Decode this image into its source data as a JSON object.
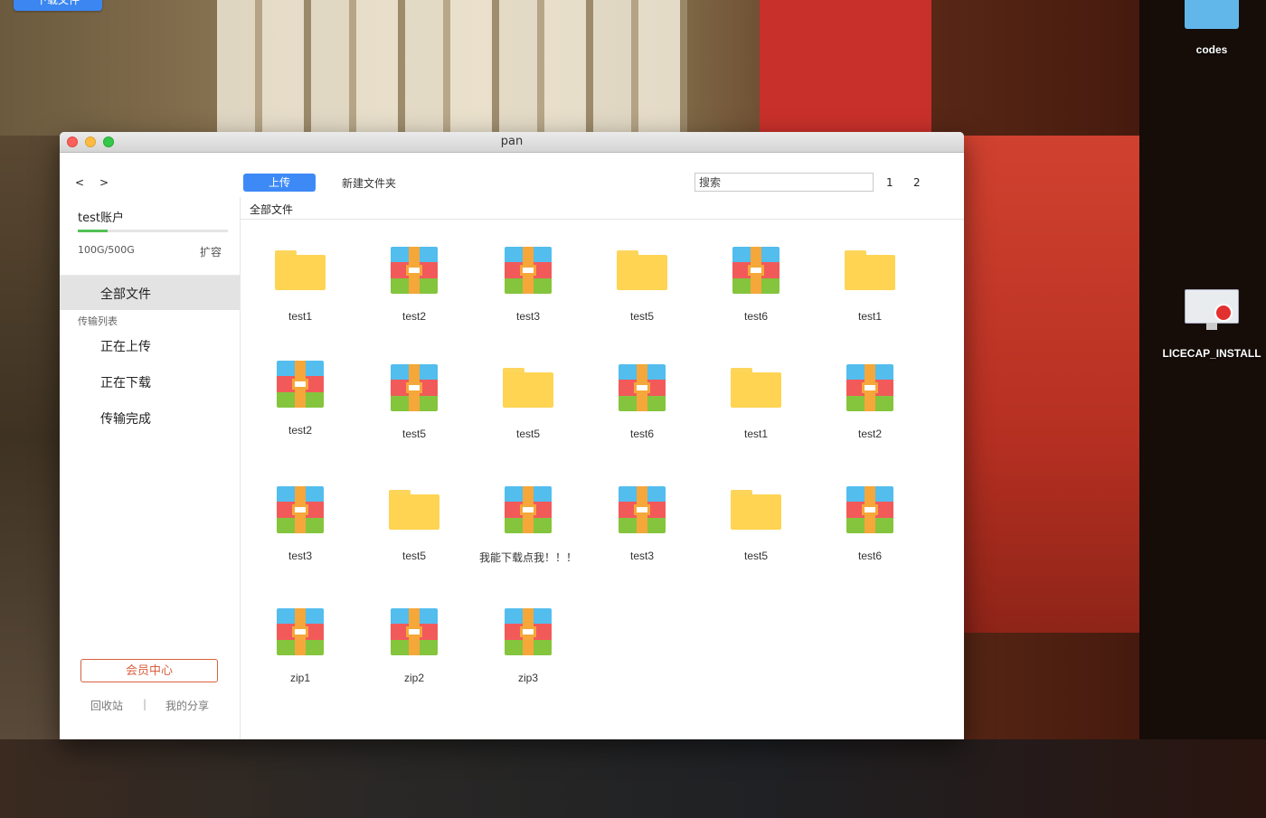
{
  "desktop": {
    "top_button_label": "下载文件",
    "icons": [
      {
        "label": "codes",
        "icon": "folder-icon"
      },
      {
        "label": "LICECAP_INSTALL",
        "icon": "licecap-installer-icon"
      }
    ]
  },
  "window": {
    "title": "pan"
  },
  "toolbar": {
    "back_label": "<",
    "forward_label": ">",
    "upload_label": "上传",
    "new_folder_label": "新建文件夹",
    "search_placeholder": "搜索",
    "pages": [
      "1",
      "2"
    ]
  },
  "sidebar": {
    "account_name": "test账户",
    "quota_text": "100G/500G",
    "quota_used_fraction": 0.2,
    "expand_label": "扩容",
    "all_files_label": "全部文件",
    "transfer_section_label": "传输列表",
    "transfer_items": [
      "正在上传",
      "正在下载",
      "传输完成"
    ],
    "vip_label": "会员中心",
    "recycle_label": "回收站",
    "separator": "|",
    "share_label": "我的分享"
  },
  "main": {
    "breadcrumb": "全部文件",
    "files": [
      {
        "name": "test1",
        "type": "folder"
      },
      {
        "name": "test2",
        "type": "archive"
      },
      {
        "name": "test3",
        "type": "archive"
      },
      {
        "name": "test5",
        "type": "folder"
      },
      {
        "name": "test6",
        "type": "archive"
      },
      {
        "name": "test1",
        "type": "folder"
      },
      {
        "name": "test2",
        "type": "archive"
      },
      {
        "name": "test5",
        "type": "archive"
      },
      {
        "name": "test5",
        "type": "folder"
      },
      {
        "name": "test6",
        "type": "archive"
      },
      {
        "name": "test1",
        "type": "folder"
      },
      {
        "name": "test2",
        "type": "archive"
      },
      {
        "name": "test3",
        "type": "archive"
      },
      {
        "name": "test5",
        "type": "folder"
      },
      {
        "name": "我能下载点我！！！",
        "type": "archive"
      },
      {
        "name": "test3",
        "type": "archive"
      },
      {
        "name": "test5",
        "type": "folder"
      },
      {
        "name": "test6",
        "type": "archive"
      },
      {
        "name": "zip1",
        "type": "archive"
      },
      {
        "name": "zip2",
        "type": "archive"
      },
      {
        "name": "zip3",
        "type": "archive"
      }
    ]
  },
  "colors": {
    "accent": "#3d8af7",
    "quota_fill": "#52c255",
    "vip": "#d9603e",
    "folder": "#fed452"
  }
}
